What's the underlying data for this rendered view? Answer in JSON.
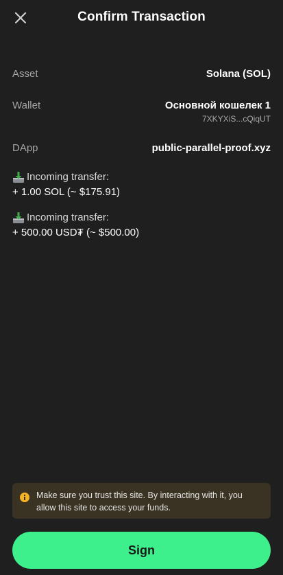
{
  "header": {
    "title": "Confirm Transaction",
    "close_icon": "close-icon"
  },
  "details": {
    "asset_label": "Asset",
    "asset_value": "Solana (SOL)",
    "wallet_label": "Wallet",
    "wallet_name": "Основной кошелек 1",
    "wallet_address": "7XKYXiS...cQiqUT",
    "dapp_label": "DApp",
    "dapp_value": "public-parallel-proof.xyz"
  },
  "transfers": [
    {
      "icon": "download-tray-icon",
      "label": "Incoming transfer:",
      "amount": "+ 1.00 SOL (~ $175.91)"
    },
    {
      "icon": "download-tray-icon",
      "label": "Incoming transfer:",
      "amount": "+ 500.00 USD₮ (~ $500.00)"
    }
  ],
  "warning": {
    "icon": "info-icon",
    "text": "Make sure you trust this site. By interacting with it, you allow this site to access your funds."
  },
  "actions": {
    "sign_label": "Sign"
  },
  "colors": {
    "background": "#1f1f1f",
    "accent": "#3df08c",
    "warning_bg": "#3a3222",
    "warning_icon": "#f5b324"
  }
}
